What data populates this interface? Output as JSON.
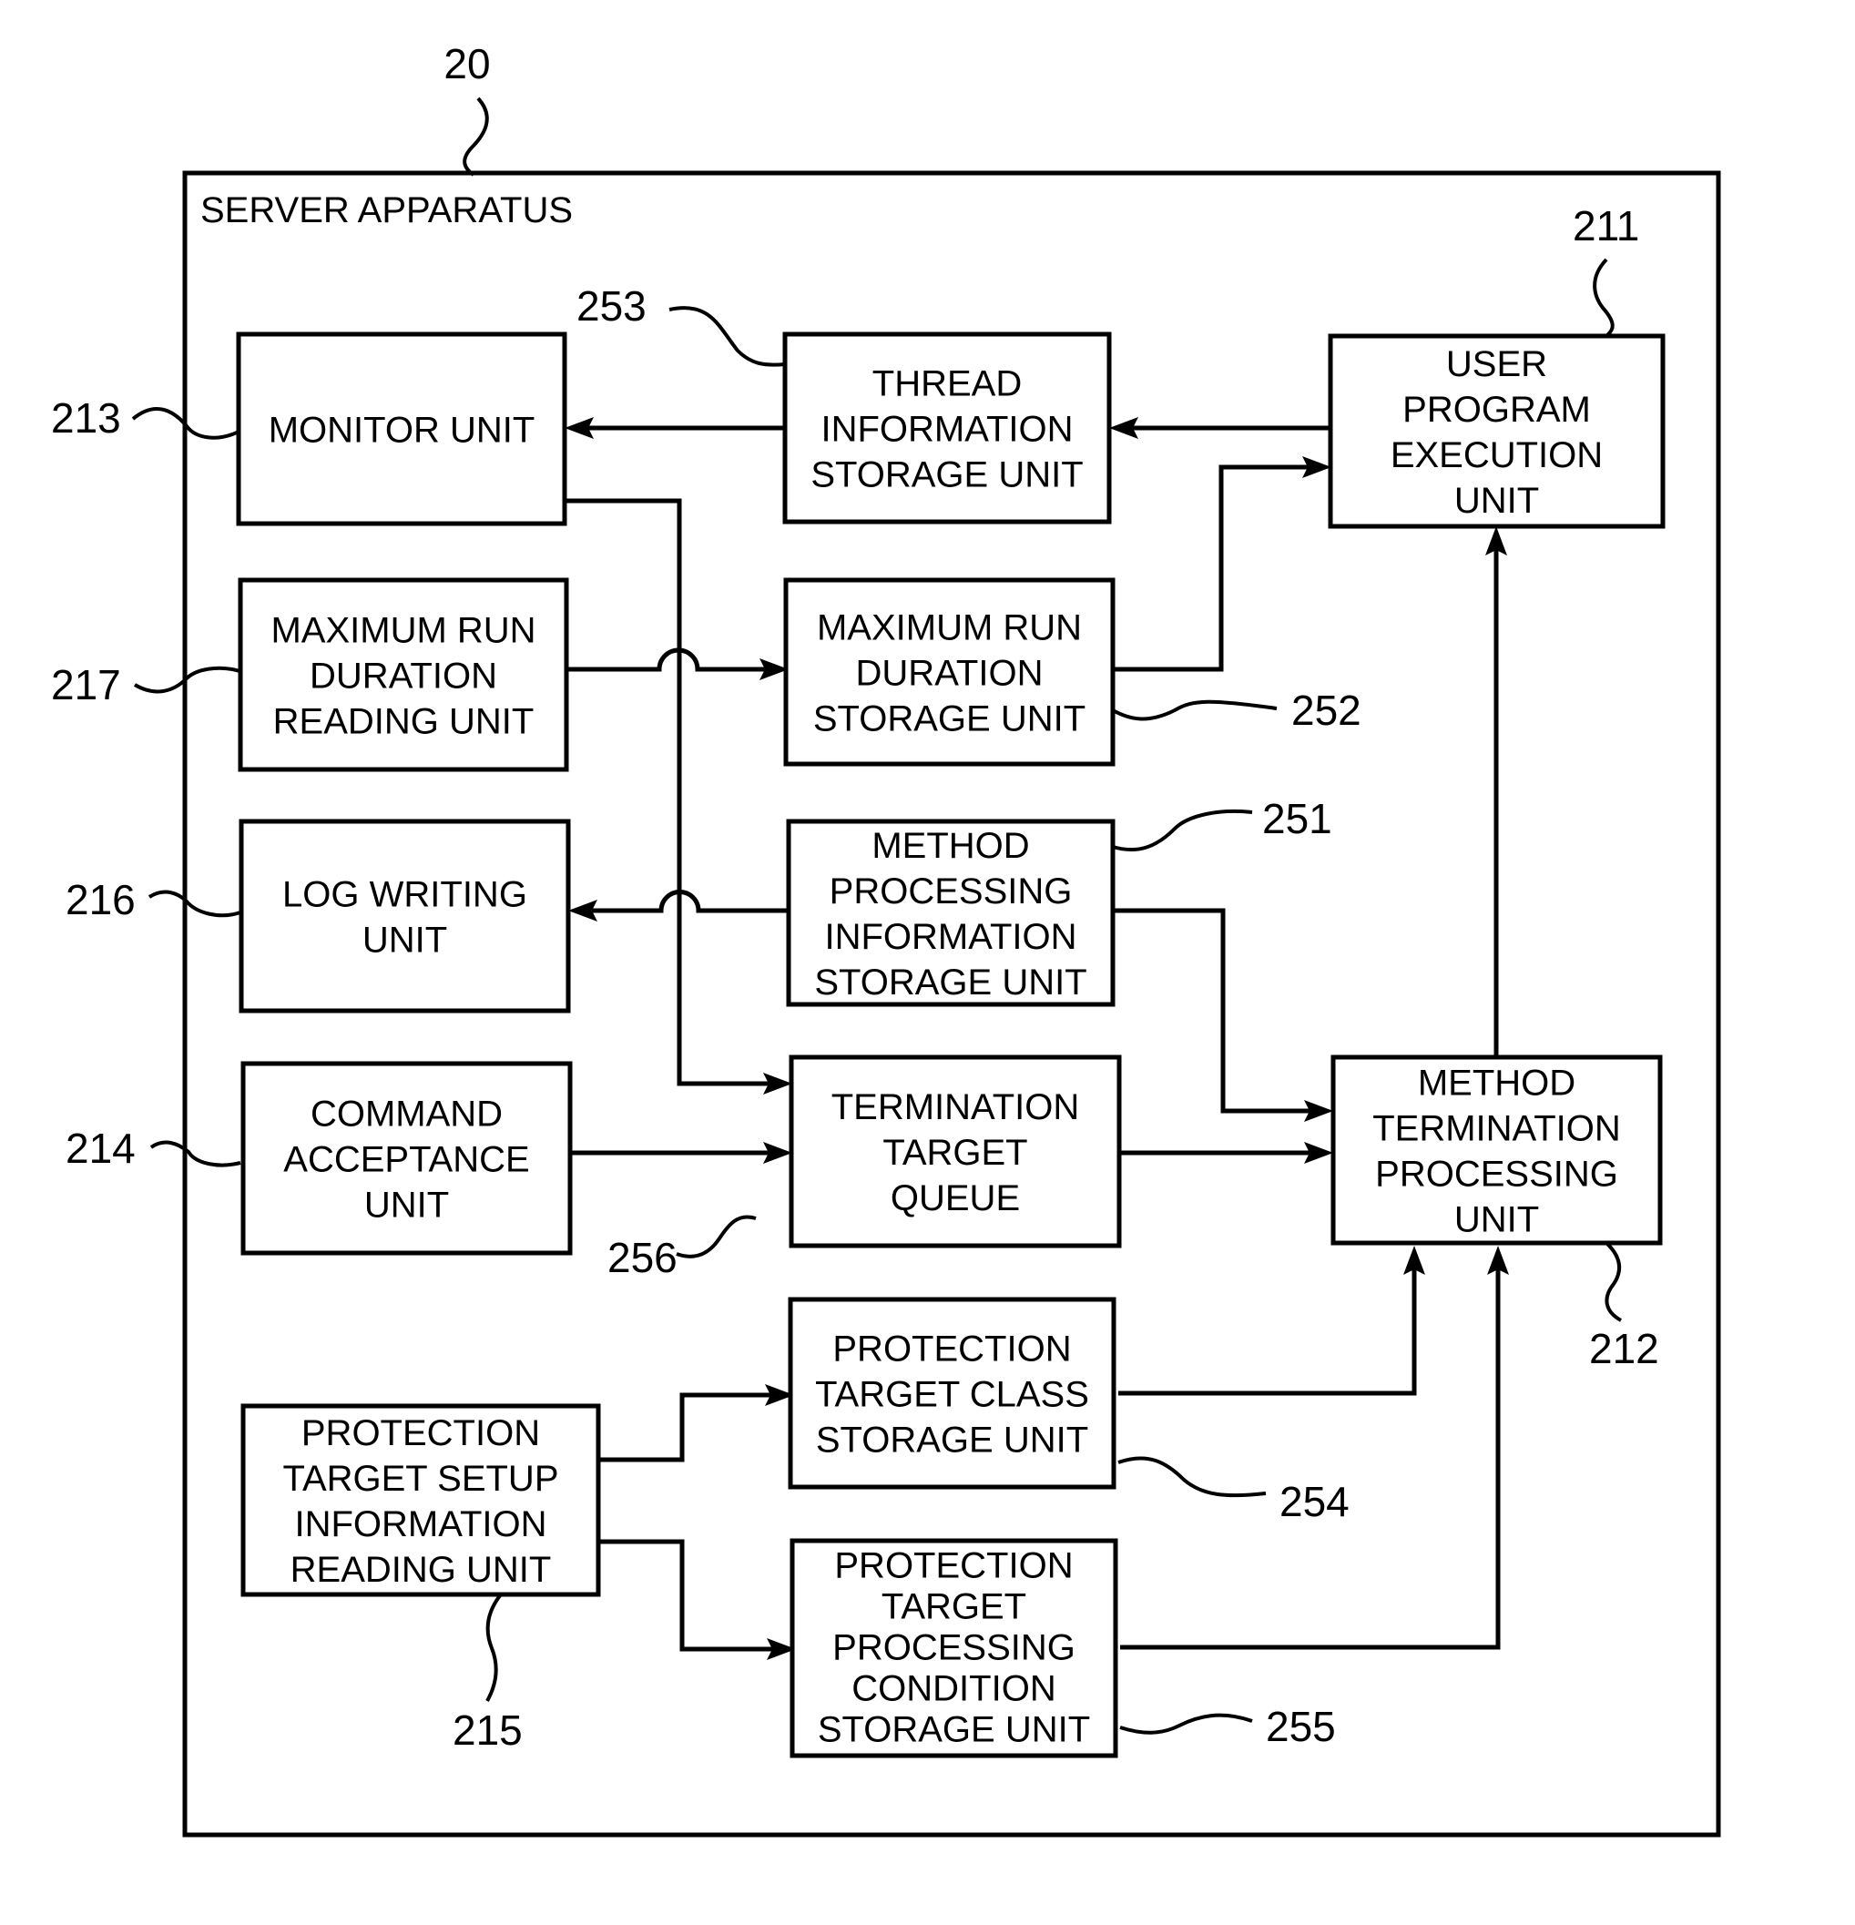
{
  "figure_ref": "20",
  "container": {
    "title": "SERVER APPARATUS"
  },
  "blocks": [
    {
      "id": "monitor",
      "ref": "213",
      "lines": [
        "MONITOR UNIT"
      ]
    },
    {
      "id": "thread_info",
      "ref": "253",
      "lines": [
        "THREAD",
        "INFORMATION",
        "STORAGE UNIT"
      ]
    },
    {
      "id": "user_program",
      "ref": "211",
      "lines": [
        "USER",
        "PROGRAM",
        "EXECUTION",
        "UNIT"
      ]
    },
    {
      "id": "max_run_reading",
      "ref": "217",
      "lines": [
        "MAXIMUM RUN",
        "DURATION",
        "READING UNIT"
      ]
    },
    {
      "id": "max_run_storage",
      "ref": "252",
      "lines": [
        "MAXIMUM RUN",
        "DURATION",
        "STORAGE UNIT"
      ]
    },
    {
      "id": "log_writing",
      "ref": "216",
      "lines": [
        "LOG WRITING",
        "UNIT"
      ]
    },
    {
      "id": "method_proc_info",
      "ref": "251",
      "lines": [
        "METHOD",
        "PROCESSING",
        "INFORMATION",
        "STORAGE UNIT"
      ]
    },
    {
      "id": "command",
      "ref": "214",
      "lines": [
        "COMMAND",
        "ACCEPTANCE",
        "UNIT"
      ]
    },
    {
      "id": "queue",
      "ref": "256",
      "lines": [
        "TERMINATION",
        "TARGET",
        "QUEUE"
      ]
    },
    {
      "id": "method_termination",
      "ref": "212",
      "lines": [
        "METHOD",
        "TERMINATION",
        "PROCESSING",
        "UNIT"
      ]
    },
    {
      "id": "class_storage",
      "ref": "254",
      "lines": [
        "PROTECTION",
        "TARGET CLASS",
        "STORAGE UNIT"
      ]
    },
    {
      "id": "setup_reading",
      "ref": "215",
      "lines": [
        "PROTECTION",
        "TARGET SETUP",
        "INFORMATION",
        "READING UNIT"
      ]
    },
    {
      "id": "condition_storage",
      "ref": "255",
      "lines": [
        "PROTECTION",
        "TARGET",
        "PROCESSING",
        "CONDITION",
        "STORAGE UNIT"
      ]
    }
  ],
  "connections": [
    {
      "from": "user_program",
      "to": "thread_info"
    },
    {
      "from": "thread_info",
      "to": "monitor"
    },
    {
      "from": "monitor",
      "to": "queue"
    },
    {
      "from": "max_run_reading",
      "to": "max_run_storage"
    },
    {
      "from": "max_run_storage",
      "to": "user_program"
    },
    {
      "from": "method_proc_info",
      "to": "log_writing"
    },
    {
      "from": "method_proc_info",
      "to": "method_termination"
    },
    {
      "from": "command",
      "to": "queue"
    },
    {
      "from": "queue",
      "to": "method_termination"
    },
    {
      "from": "method_termination",
      "to": "user_program"
    },
    {
      "from": "class_storage",
      "to": "method_termination"
    },
    {
      "from": "condition_storage",
      "to": "method_termination"
    },
    {
      "from": "setup_reading",
      "to": "class_storage"
    },
    {
      "from": "setup_reading",
      "to": "condition_storage"
    }
  ]
}
